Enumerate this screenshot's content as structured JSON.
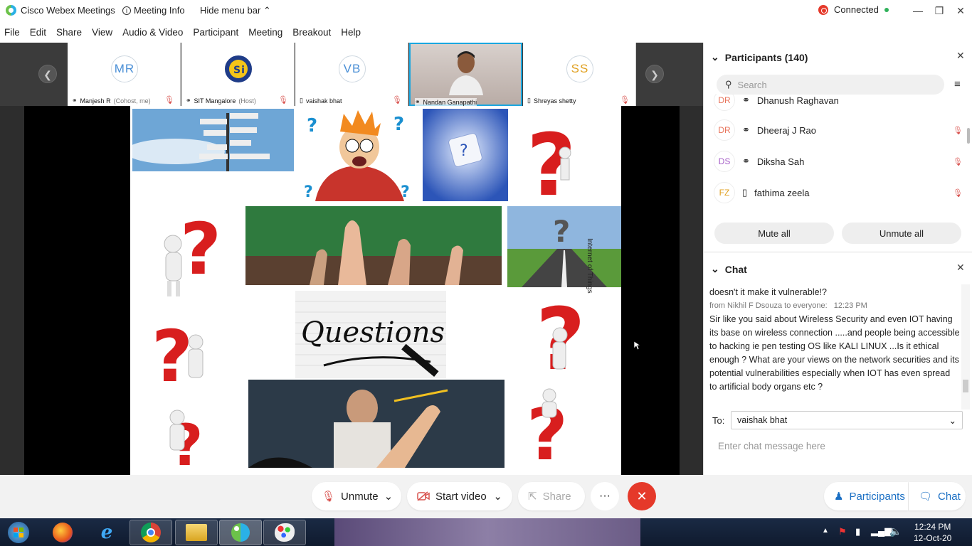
{
  "window": {
    "app_title": "Cisco Webex Meetings",
    "meeting_info": "Meeting Info",
    "hide_menu_bar": "Hide menu bar",
    "connection_status": "Connected"
  },
  "menu": [
    "File",
    "Edit",
    "Share",
    "View",
    "Audio & Video",
    "Participant",
    "Meeting",
    "Breakout",
    "Help"
  ],
  "thumbnails": [
    {
      "initials": "MR",
      "name": "Manjesh R",
      "role": "(Cohost, me)",
      "color": "#4a8fd6"
    },
    {
      "initials": "",
      "name": "SIT Mangalore",
      "role": "(Host)",
      "color": "#1f3c88"
    },
    {
      "initials": "VB",
      "name": "vaishak bhat",
      "role": "",
      "color": "#4a8fd6"
    },
    {
      "initials": "",
      "name": "Nandan Ganapathi",
      "role": "",
      "color": "#666"
    },
    {
      "initials": "SS",
      "name": "Shreyas shetty",
      "role": "",
      "color": "#e0a020"
    }
  ],
  "slide": {
    "vertical_caption": "Internet of Things"
  },
  "controls": {
    "unmute": "Unmute",
    "start_video": "Start video",
    "share": "Share",
    "more": "···",
    "participants": "Participants",
    "chat": "Chat"
  },
  "participants_panel": {
    "title": "Participants (140)",
    "search_placeholder": "Search",
    "rows": [
      {
        "initials": "DR",
        "name": "Dhanush Raghavan",
        "color": "#e8735a"
      },
      {
        "initials": "DR",
        "name": "Dheeraj J Rao",
        "color": "#e8735a"
      },
      {
        "initials": "DS",
        "name": "Diksha Sah",
        "color": "#a65fc7"
      },
      {
        "initials": "FZ",
        "name": "fathima zeela",
        "color": "#e0a020"
      }
    ],
    "mute_all": "Mute all",
    "unmute_all": "Unmute all"
  },
  "chat_panel": {
    "title": "Chat",
    "prev_message_tail": "doesn't it make it vulnerable!?",
    "sender_line": "from Nikhil F Dsouza to everyone:",
    "time": "12:23 PM",
    "message": "Sir like you said about Wireless Security and even IOT having its base on wireless connection .....and people being accessible to hacking ie pen testing OS like KALI LINUX ...Is it ethical enough ? What are your views on the network securities and its potential vulnerabilities especially when IOT has even spread to artificial body organs etc ?",
    "to_label": "To:",
    "to_value": "vaishak bhat",
    "input_placeholder": "Enter chat message here"
  },
  "taskbar": {
    "time": "12:24 PM",
    "date": "12-Oct-20"
  }
}
